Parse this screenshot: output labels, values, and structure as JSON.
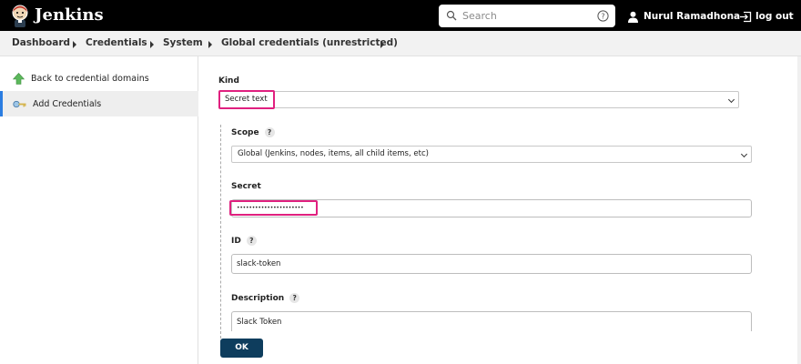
{
  "header": {
    "brand": "Jenkins",
    "search_placeholder": "Search",
    "user_name": "Nurul Ramadhona",
    "logout_label": "log out"
  },
  "breadcrumb": {
    "items": [
      "Dashboard",
      "Credentials",
      "System",
      "Global credentials (unrestricted)"
    ]
  },
  "sidebar": {
    "items": [
      {
        "label": "Back to credential domains",
        "icon": "green-up-arrow-icon"
      },
      {
        "label": "Add Credentials",
        "icon": "key-icon",
        "active": true
      }
    ]
  },
  "form": {
    "kind": {
      "label": "Kind",
      "value": "Secret text"
    },
    "scope": {
      "label": "Scope",
      "value": "Global (Jenkins, nodes, items, all child items, etc)"
    },
    "secret": {
      "label": "Secret",
      "value": "••••••••••••••••••••••"
    },
    "id": {
      "label": "ID",
      "value": "slack-token"
    },
    "description": {
      "label": "Description",
      "value": "Slack Token"
    },
    "help_glyph": "?",
    "ok_label": "OK"
  },
  "colors": {
    "header_bg": "#000000",
    "highlight": "#e0207f",
    "ok_button": "#0e3d5d",
    "active_border": "#2b7de1"
  }
}
